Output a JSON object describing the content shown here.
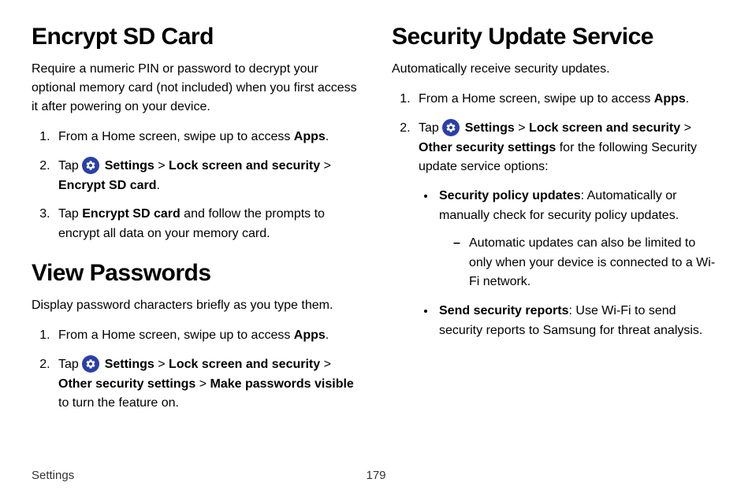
{
  "left": {
    "section1": {
      "heading": "Encrypt SD Card",
      "intro": "Require a numeric PIN or password to decrypt your optional memory card (not included) when you first access it after powering on your device.",
      "step1_prefix": "From a Home screen, swipe up to access ",
      "step1_bold": "Apps",
      "step1_suffix": ".",
      "step2_prefix": "Tap ",
      "step2_settings": " Settings",
      "step2_gt1": " > ",
      "step2_lock": "Lock screen and security",
      "step2_gt2": " > ",
      "step2_encrypt": "Encrypt SD card",
      "step2_suffix": ".",
      "step3_prefix": "Tap ",
      "step3_bold": "Encrypt SD card",
      "step3_suffix": " and follow the prompts to encrypt all data on your memory card."
    },
    "section2": {
      "heading": "View Passwords",
      "intro": "Display password characters briefly as you type them.",
      "step1_prefix": "From a Home screen, swipe up to access ",
      "step1_bold": "Apps",
      "step1_suffix": ".",
      "step2_prefix": "Tap ",
      "step2_settings": " Settings",
      "step2_gt1": " > ",
      "step2_lock": "Lock screen and security",
      "step2_gt2": " > ",
      "step2_other": "Other security settings",
      "step2_gt3": " > ",
      "step2_make": "Make passwords visible",
      "step2_suffix": " to turn the feature on."
    }
  },
  "right": {
    "heading": "Security Update Service",
    "intro": "Automatically receive security updates.",
    "step1_prefix": "From a Home screen, swipe up to access ",
    "step1_bold": "Apps",
    "step1_suffix": ".",
    "step2_prefix": "Tap ",
    "step2_settings": " Settings",
    "step2_gt1": " > ",
    "step2_lock": "Lock screen and security",
    "step2_gt2": " > ",
    "step2_other": "Other security settings",
    "step2_suffix": " for the following Security update service options:",
    "bullet1_bold": "Security policy updates",
    "bullet1_text": ": Automatically or manually check for security policy updates.",
    "bullet1_sub": "Automatic updates can also be limited to only when your device is connected to a Wi-Fi network.",
    "bullet2_bold": "Send security reports",
    "bullet2_text": ": Use Wi-Fi to send security reports to Samsung for threat analysis."
  },
  "footer": {
    "section": "Settings",
    "page": "179"
  }
}
